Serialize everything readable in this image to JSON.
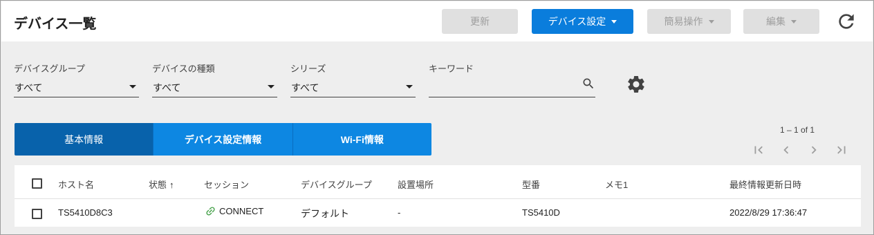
{
  "header": {
    "title": "デバイス一覧",
    "buttons": {
      "update": "更新",
      "device_settings": "デバイス設定",
      "easy_operations": "簡易操作",
      "edit": "編集"
    }
  },
  "filters": {
    "device_group": {
      "label": "デバイスグループ",
      "value": "すべて"
    },
    "device_type": {
      "label": "デバイスの種類",
      "value": "すべて"
    },
    "series": {
      "label": "シリーズ",
      "value": "すべて"
    },
    "keyword": {
      "label": "キーワード",
      "value": ""
    }
  },
  "tabs": [
    {
      "label": "基本情報",
      "active": true
    },
    {
      "label": "デバイス設定情報",
      "active": false
    },
    {
      "label": "Wi-Fi情報",
      "active": false
    }
  ],
  "pagination": {
    "text": "1 – 1 of 1"
  },
  "table": {
    "columns": {
      "host": "ホスト名",
      "status": "状態",
      "session": "セッション",
      "group": "デバイスグループ",
      "location": "設置場所",
      "model": "型番",
      "memo": "メモ1",
      "updated": "最終情報更新日時"
    },
    "rows": [
      {
        "host": "TS5410D8C3",
        "status": "",
        "session": "CONNECT",
        "group": "デフォルト",
        "location": "-",
        "model": "TS5410D",
        "memo": "",
        "updated": "2022/8/29 17:36:47"
      }
    ]
  },
  "colors": {
    "primary": "#0a7ddc",
    "tab_active": "#0862ab",
    "tab": "#0d87e2",
    "connect": "#43a047"
  }
}
